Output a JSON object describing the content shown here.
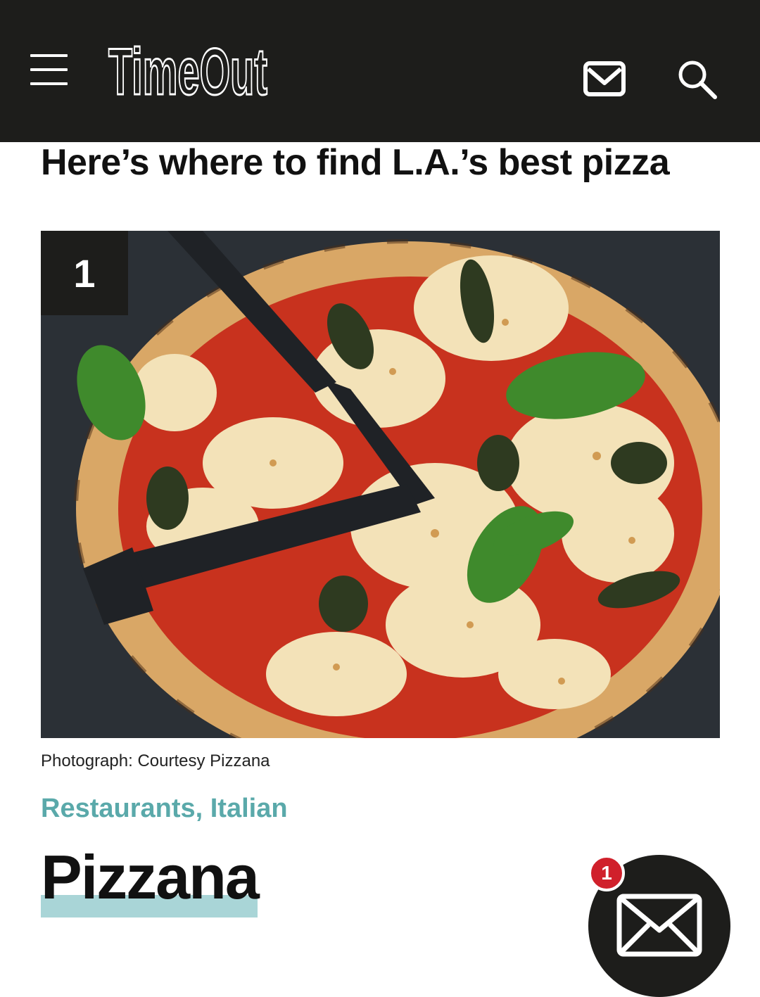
{
  "header": {
    "logo_text": "TimeOut",
    "menu_icon": "hamburger-menu-icon",
    "mail_icon": "envelope-icon",
    "search_icon": "search-icon",
    "background": "#1d1d1b"
  },
  "article": {
    "headline": "Here’s where to find L.A.’s best pizza"
  },
  "listing": {
    "rank": "1",
    "photo_description": "Margherita pizza with basil on a dark slate",
    "photo_credit": "Photograph: Courtesy Pizzana",
    "category": "Restaurants, Italian",
    "name": "Pizzana"
  },
  "newsletter_fab": {
    "icon": "envelope-icon",
    "badge_count": "1",
    "badge_color": "#d0202b"
  },
  "colors": {
    "accent_teal": "#5aa9aa",
    "underline_teal": "#a9d5d7"
  }
}
